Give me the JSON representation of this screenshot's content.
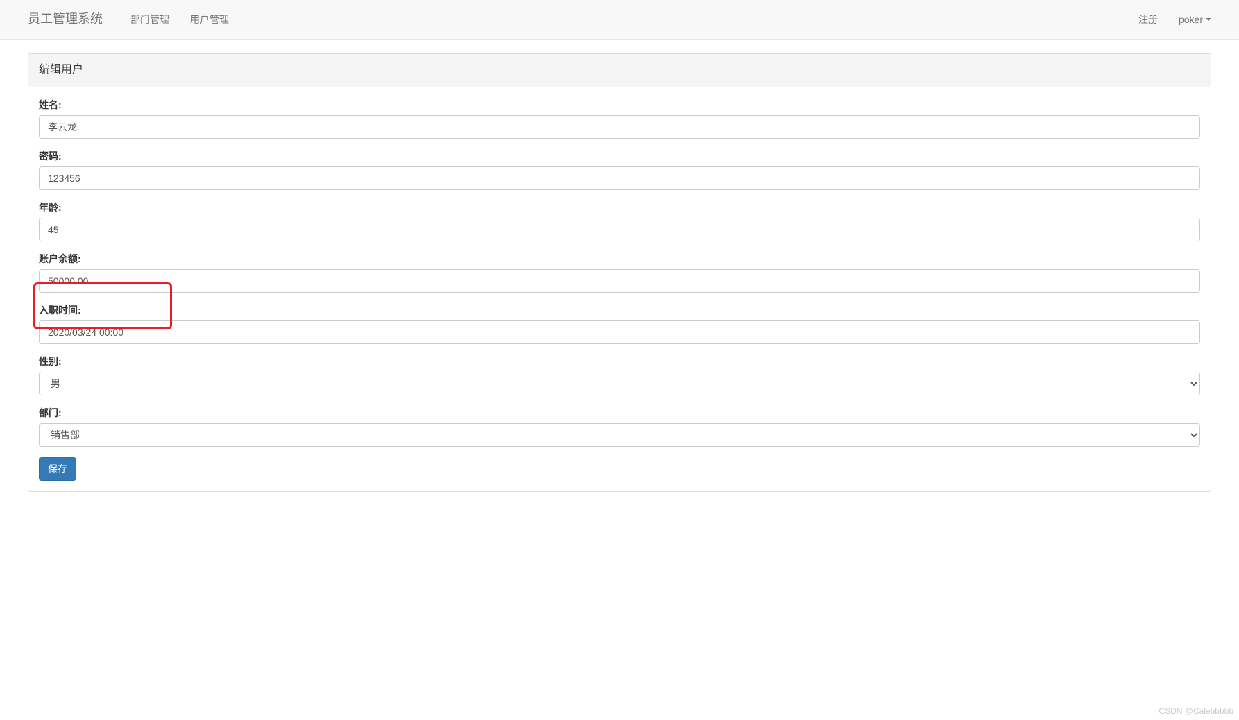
{
  "navbar": {
    "brand": "员工管理系统",
    "links": [
      {
        "label": "部门管理"
      },
      {
        "label": "用户管理"
      }
    ],
    "right_links": [
      {
        "label": "注册"
      },
      {
        "label": "poker",
        "dropdown": true
      }
    ]
  },
  "panel": {
    "title": "编辑用户"
  },
  "form": {
    "name": {
      "label": "姓名:",
      "value": "李云龙"
    },
    "password": {
      "label": "密码:",
      "value": "123456"
    },
    "age": {
      "label": "年龄:",
      "value": "45"
    },
    "balance": {
      "label": "账户余额:",
      "value": "50000.00"
    },
    "join_time": {
      "label": "入职时间:",
      "value": "2020/03/24 00:00"
    },
    "gender": {
      "label": "性别:",
      "value": "男"
    },
    "department": {
      "label": "部门:",
      "value": "销售部"
    },
    "submit": {
      "label": "保存"
    }
  },
  "watermark": "CSDN @Calebbbbb"
}
